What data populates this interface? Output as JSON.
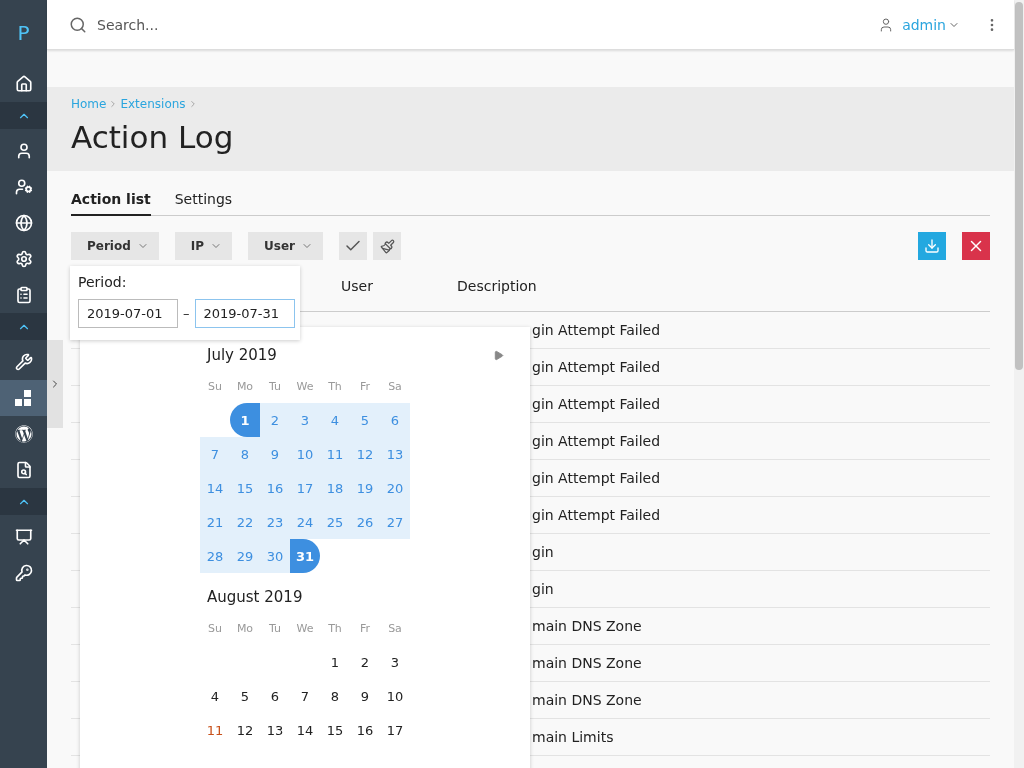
{
  "sidebar": {
    "logo": "P",
    "items": [
      {
        "kind": "item",
        "selected": false
      },
      {
        "kind": "group",
        "selected": false
      },
      {
        "kind": "item",
        "selected": false
      },
      {
        "kind": "item",
        "selected": false
      },
      {
        "kind": "item",
        "selected": false
      },
      {
        "kind": "item",
        "selected": false
      },
      {
        "kind": "item",
        "selected": false
      },
      {
        "kind": "group",
        "selected": false
      },
      {
        "kind": "item",
        "selected": false
      },
      {
        "kind": "item",
        "selected": true
      },
      {
        "kind": "item",
        "selected": false
      },
      {
        "kind": "item",
        "selected": false
      },
      {
        "kind": "group",
        "selected": false
      },
      {
        "kind": "item",
        "selected": false
      },
      {
        "kind": "item",
        "selected": false
      }
    ]
  },
  "topbar": {
    "search_placeholder": "Search...",
    "user": "admin"
  },
  "breadcrumb": [
    "Home",
    "Extensions"
  ],
  "title": "Action Log",
  "tabs": [
    {
      "label": "Action list",
      "selected": true
    },
    {
      "label": "Settings",
      "selected": false
    }
  ],
  "filters": [
    "Period",
    "IP",
    "User"
  ],
  "table": {
    "columns": [
      "User",
      "Description"
    ],
    "rows": [
      "gin Attempt Failed",
      "gin Attempt Failed",
      "gin Attempt Failed",
      "gin Attempt Failed",
      "gin Attempt Failed",
      "gin Attempt Failed",
      "gin",
      "gin",
      "main DNS Zone",
      "main DNS Zone",
      "main DNS Zone",
      "main Limits"
    ]
  },
  "period_popover": {
    "label": "Period:",
    "from": "2019-07-01",
    "separator": "–",
    "to": "2019-07-31"
  },
  "calendar": {
    "months": [
      {
        "title": "July 2019",
        "weekdays": [
          "Su",
          "Mo",
          "Tu",
          "We",
          "Th",
          "Fr",
          "Sa"
        ],
        "weeks": [
          [
            {
              "kind": "blank"
            },
            {
              "kind": "day",
              "day": "1",
              "in_range": true,
              "selected": true,
              "today": false
            },
            {
              "kind": "day",
              "day": "2",
              "in_range": true,
              "selected": false,
              "today": false
            },
            {
              "kind": "day",
              "day": "3",
              "in_range": true,
              "selected": false,
              "today": false
            },
            {
              "kind": "day",
              "day": "4",
              "in_range": true,
              "selected": false,
              "today": false
            },
            {
              "kind": "day",
              "day": "5",
              "in_range": true,
              "selected": false,
              "today": false
            },
            {
              "kind": "day",
              "day": "6",
              "in_range": true,
              "selected": false,
              "today": false
            }
          ],
          [
            {
              "kind": "day",
              "day": "7",
              "in_range": true,
              "selected": false,
              "today": false
            },
            {
              "kind": "day",
              "day": "8",
              "in_range": true,
              "selected": false,
              "today": false
            },
            {
              "kind": "day",
              "day": "9",
              "in_range": true,
              "selected": false,
              "today": false
            },
            {
              "kind": "day",
              "day": "10",
              "in_range": true,
              "selected": false,
              "today": false
            },
            {
              "kind": "day",
              "day": "11",
              "in_range": true,
              "selected": false,
              "today": false
            },
            {
              "kind": "day",
              "day": "12",
              "in_range": true,
              "selected": false,
              "today": false
            },
            {
              "kind": "day",
              "day": "13",
              "in_range": true,
              "selected": false,
              "today": false
            }
          ],
          [
            {
              "kind": "day",
              "day": "14",
              "in_range": true,
              "selected": false,
              "today": false
            },
            {
              "kind": "day",
              "day": "15",
              "in_range": true,
              "selected": false,
              "today": false
            },
            {
              "kind": "day",
              "day": "16",
              "in_range": true,
              "selected": false,
              "today": false
            },
            {
              "kind": "day",
              "day": "17",
              "in_range": true,
              "selected": false,
              "today": false
            },
            {
              "kind": "day",
              "day": "18",
              "in_range": true,
              "selected": false,
              "today": false
            },
            {
              "kind": "day",
              "day": "19",
              "in_range": true,
              "selected": false,
              "today": false
            },
            {
              "kind": "day",
              "day": "20",
              "in_range": true,
              "selected": false,
              "today": false
            }
          ],
          [
            {
              "kind": "day",
              "day": "21",
              "in_range": true,
              "selected": false,
              "today": false
            },
            {
              "kind": "day",
              "day": "22",
              "in_range": true,
              "selected": false,
              "today": false
            },
            {
              "kind": "day",
              "day": "23",
              "in_range": true,
              "selected": false,
              "today": false
            },
            {
              "kind": "day",
              "day": "24",
              "in_range": true,
              "selected": false,
              "today": false
            },
            {
              "kind": "day",
              "day": "25",
              "in_range": true,
              "selected": false,
              "today": false
            },
            {
              "kind": "day",
              "day": "26",
              "in_range": true,
              "selected": false,
              "today": false
            },
            {
              "kind": "day",
              "day": "27",
              "in_range": true,
              "selected": false,
              "today": false
            }
          ],
          [
            {
              "kind": "day",
              "day": "28",
              "in_range": true,
              "selected": false,
              "today": false
            },
            {
              "kind": "day",
              "day": "29",
              "in_range": true,
              "selected": false,
              "today": false
            },
            {
              "kind": "day",
              "day": "30",
              "in_range": true,
              "selected": false,
              "today": false
            },
            {
              "kind": "day",
              "day": "31",
              "in_range": true,
              "selected": true,
              "today": false
            }
          ]
        ]
      },
      {
        "title": "August 2019",
        "weekdays": [
          "Su",
          "Mo",
          "Tu",
          "We",
          "Th",
          "Fr",
          "Sa"
        ],
        "weeks": [
          [
            {
              "kind": "blank"
            },
            {
              "kind": "blank"
            },
            {
              "kind": "blank"
            },
            {
              "kind": "blank"
            },
            {
              "kind": "day",
              "day": "1",
              "in_range": false,
              "selected": false,
              "today": false
            },
            {
              "kind": "day",
              "day": "2",
              "in_range": false,
              "selected": false,
              "today": false
            },
            {
              "kind": "day",
              "day": "3",
              "in_range": false,
              "selected": false,
              "today": false
            }
          ],
          [
            {
              "kind": "day",
              "day": "4",
              "in_range": false,
              "selected": false,
              "today": false
            },
            {
              "kind": "day",
              "day": "5",
              "in_range": false,
              "selected": false,
              "today": false
            },
            {
              "kind": "day",
              "day": "6",
              "in_range": false,
              "selected": false,
              "today": false
            },
            {
              "kind": "day",
              "day": "7",
              "in_range": false,
              "selected": false,
              "today": false
            },
            {
              "kind": "day",
              "day": "8",
              "in_range": false,
              "selected": false,
              "today": false
            },
            {
              "kind": "day",
              "day": "9",
              "in_range": false,
              "selected": false,
              "today": false
            },
            {
              "kind": "day",
              "day": "10",
              "in_range": false,
              "selected": false,
              "today": false
            }
          ],
          [
            {
              "kind": "day",
              "day": "11",
              "in_range": false,
              "selected": false,
              "today": true
            },
            {
              "kind": "day",
              "day": "12",
              "in_range": false,
              "selected": false,
              "today": false
            },
            {
              "kind": "day",
              "day": "13",
              "in_range": false,
              "selected": false,
              "today": false
            },
            {
              "kind": "day",
              "day": "14",
              "in_range": false,
              "selected": false,
              "today": false
            },
            {
              "kind": "day",
              "day": "15",
              "in_range": false,
              "selected": false,
              "today": false
            },
            {
              "kind": "day",
              "day": "16",
              "in_range": false,
              "selected": false,
              "today": false
            },
            {
              "kind": "day",
              "day": "17",
              "in_range": false,
              "selected": false,
              "today": false
            }
          ]
        ]
      }
    ]
  }
}
